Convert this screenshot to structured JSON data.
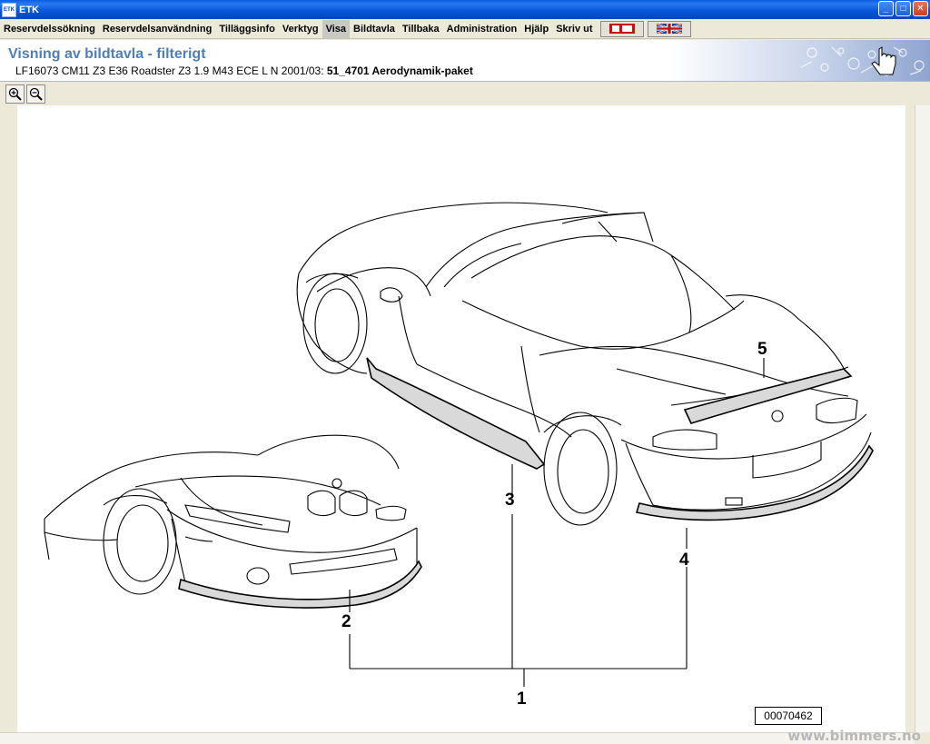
{
  "window": {
    "app_icon_text": "ETK",
    "title": "ETK",
    "minimize": "_",
    "maximize": "□",
    "close": "✕"
  },
  "menu": {
    "items": [
      "Reservdelssökning",
      "Reservdelsanvändning",
      "Tilläggsinfo",
      "Verktyg",
      "Visa",
      "Bildtavla",
      "Tillbaka",
      "Administration",
      "Hjälp",
      "Skriv ut"
    ],
    "active_index": 4
  },
  "header": {
    "title": "Visning av bildtavla - filterigt",
    "vehicle": "LF16073 CM11 Z3 E36 Roadster Z3 1.9 M43 ECE L N 2001/03:",
    "group": "51_4701 Aerodynamik-paket"
  },
  "toolbar": {
    "zoom_in_icon": "zoom-in-icon",
    "zoom_out_icon": "zoom-out-icon"
  },
  "diagram": {
    "callouts": [
      "1",
      "2",
      "3",
      "4",
      "5"
    ],
    "reference": "00070462",
    "watermark": "www.bimmers.no"
  },
  "colors": {
    "titlebar": "#0553d8",
    "title_text": "#4d7fb8",
    "menu_bg": "#ece9d8"
  }
}
